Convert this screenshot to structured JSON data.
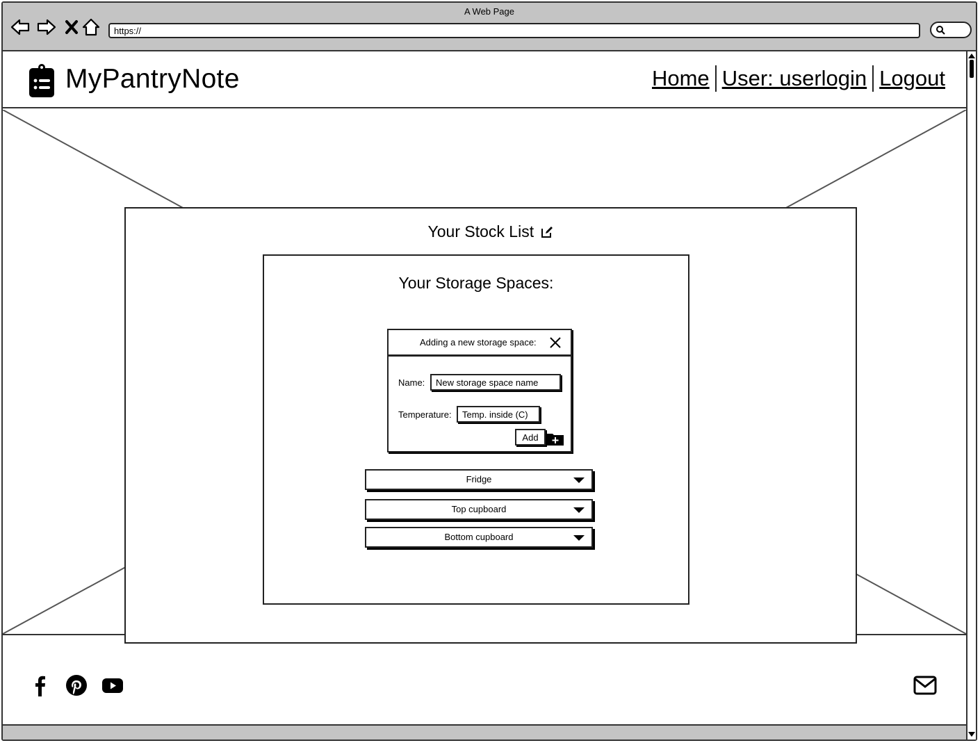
{
  "window": {
    "title": "A Web Page",
    "url": "https://"
  },
  "header": {
    "brand": "MyPantryNote",
    "nav": {
      "home": "Home",
      "user": "User: userlogin",
      "logout": "Logout"
    }
  },
  "stock": {
    "title": "Your Stock List"
  },
  "spaces": {
    "title": "Your Storage Spaces:"
  },
  "modal": {
    "title": "Adding a new storage space:",
    "name_label": "Name:",
    "name_placeholder": "New storage space name",
    "temp_label": "Temperature:",
    "temp_placeholder": "Temp. inside (C)",
    "add_label": "Add"
  },
  "storage_spaces": [
    {
      "label": "Fridge"
    },
    {
      "label": "Top cupboard"
    },
    {
      "label": "Bottom cupboard"
    }
  ],
  "footer": {
    "icons": [
      "facebook-icon",
      "pinterest-icon",
      "youtube-icon",
      "mail-icon"
    ]
  }
}
